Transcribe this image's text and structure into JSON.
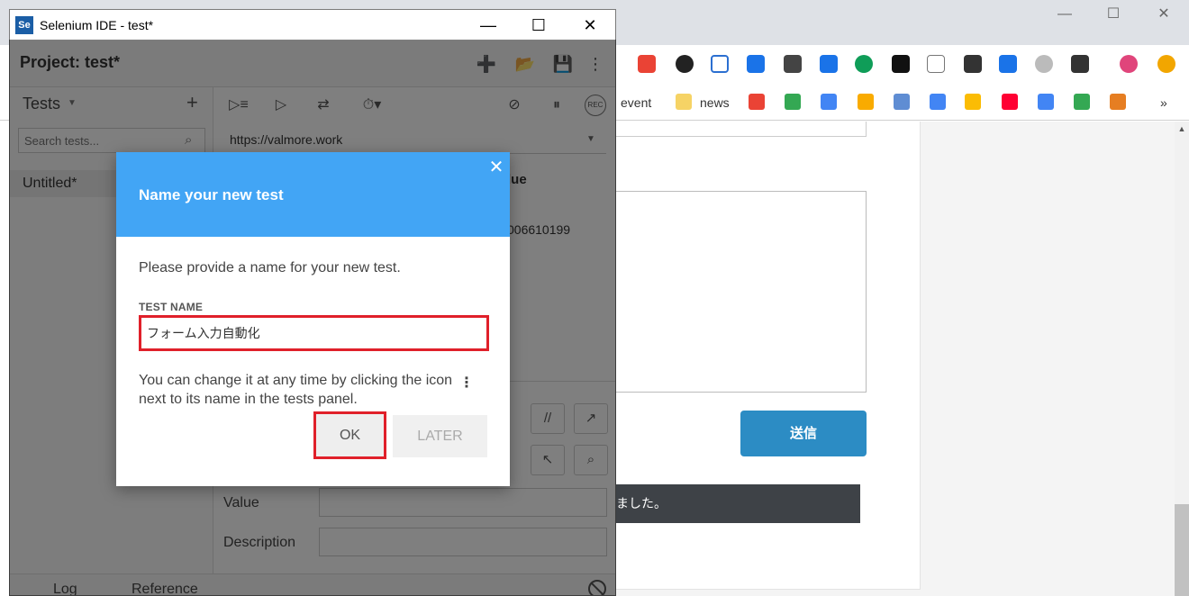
{
  "browser": {
    "bookmarks": [
      {
        "label": "event"
      },
      {
        "label": "news"
      }
    ],
    "page": {
      "send_button": "送信",
      "banner_text": "ました。"
    }
  },
  "ide": {
    "window_title": "Selenium IDE - test*",
    "logo_text": "Se",
    "project_label": "Project:  test*",
    "sidebar": {
      "tests_label": "Tests",
      "search_placeholder": "Search tests...",
      "test_item": "Untitled*"
    },
    "main": {
      "url": "https://valmore.work",
      "value_header": "lue",
      "value_cell": "006610199",
      "rec_label": "REC",
      "value_field_label": "Value",
      "description_field_label": "Description",
      "comment_btn": "//"
    },
    "footer": {
      "log_tab": "Log",
      "reference_tab": "Reference"
    }
  },
  "dialog": {
    "title": "Name your new test",
    "description": "Please provide a name for your new test.",
    "field_caption": "TEST NAME",
    "field_value": "フォーム入力自動化",
    "help_text": "You can change it at any time by clicking the icon next to its name in the tests panel.",
    "ok_label": "OK",
    "later_label": "LATER"
  },
  "colors": {
    "dialog_header": "#42a5f5",
    "highlight": "#e0202a",
    "send_button": "#2c8cc4"
  }
}
